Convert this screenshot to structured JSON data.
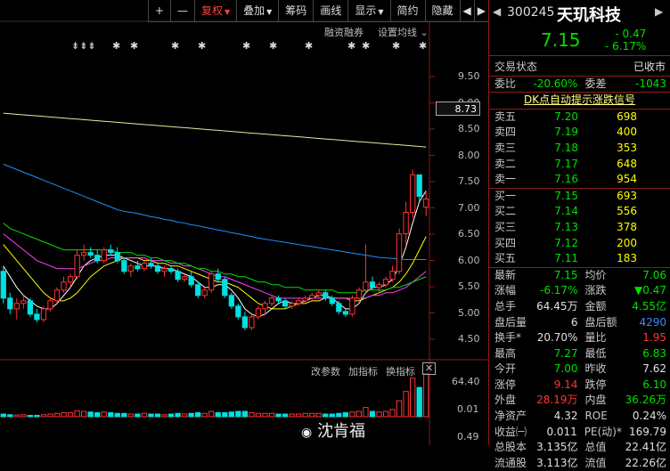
{
  "toolbar": {
    "buttons": [
      "+",
      "—",
      "复权",
      "叠加",
      "筹码",
      "画线",
      "显示",
      "简约",
      "隐藏"
    ],
    "nav_left": "◀",
    "nav_right": "▶"
  },
  "chart_header": {
    "margin_label": "融资融券",
    "ma_setting_label": "设置均线"
  },
  "price_axis": [
    "9.50",
    "9.00",
    "8.50",
    "8.00",
    "7.50",
    "7.00",
    "6.50",
    "6.00",
    "5.50",
    "5.00",
    "4.50"
  ],
  "current_price_tag": "8.73",
  "volume_panel": {
    "buttons": [
      "改参数",
      "加指标",
      "换指标"
    ],
    "close_icon": "✕",
    "axis_top": "64.40",
    "axis_bottom": "0.01",
    "axis_extra": "0.49"
  },
  "markers": [
    "⇟⇟⇟",
    "✱",
    "✱",
    "✱",
    "✱",
    "✱",
    "✱",
    "✱",
    "✱",
    "✱",
    "✱",
    "✱"
  ],
  "watermark": "沈肯福",
  "stock": {
    "nav_left": "◀",
    "code": "300245",
    "name": "天玑科技",
    "nav_right": "▶",
    "price": "7.15",
    "change": "- 0.47",
    "change_pct": "- 6.17%"
  },
  "status": {
    "label": "交易状态",
    "value": "已收市"
  },
  "ratio": {
    "wb_label": "委比",
    "wb_value": "-20.60%",
    "wc_label": "委差",
    "wc_value": "-1043"
  },
  "signal_link": "DK点自动提示涨跌信号",
  "order_book": {
    "asks": [
      {
        "label": "卖五",
        "price": "7.20",
        "vol": "698"
      },
      {
        "label": "卖四",
        "price": "7.19",
        "vol": "400"
      },
      {
        "label": "卖三",
        "price": "7.18",
        "vol": "353"
      },
      {
        "label": "卖二",
        "price": "7.17",
        "vol": "648"
      },
      {
        "label": "卖一",
        "price": "7.16",
        "vol": "954"
      }
    ],
    "bids": [
      {
        "label": "买一",
        "price": "7.15",
        "vol": "693"
      },
      {
        "label": "买二",
        "price": "7.14",
        "vol": "556"
      },
      {
        "label": "买三",
        "price": "7.13",
        "vol": "378"
      },
      {
        "label": "买四",
        "price": "7.12",
        "vol": "200"
      },
      {
        "label": "买五",
        "price": "7.11",
        "vol": "183"
      }
    ]
  },
  "stats": [
    {
      "l1": "最新",
      "v1": "7.15",
      "c1": "green",
      "l2": "均价",
      "v2": "7.06",
      "c2": "green"
    },
    {
      "l1": "涨幅",
      "v1": "-6.17%",
      "c1": "green",
      "l2": "涨跌",
      "v2": "▼0.47",
      "c2": "green"
    },
    {
      "l1": "总手",
      "v1": "64.45万",
      "c1": "white",
      "l2": "金额",
      "v2": "4.55亿",
      "c2": "green"
    },
    {
      "l1": "盘后量",
      "v1": "6",
      "c1": "white",
      "l2": "盘后额",
      "v2": "4290",
      "c2": "blue"
    },
    {
      "l1": "换手*",
      "v1": "20.70%",
      "c1": "white",
      "l2": "量比",
      "v2": "1.95",
      "c2": "red"
    },
    {
      "l1": "最高",
      "v1": "7.27",
      "c1": "green",
      "l2": "最低",
      "v2": "6.83",
      "c2": "green"
    },
    {
      "l1": "今开",
      "v1": "7.00",
      "c1": "green",
      "l2": "昨收",
      "v2": "7.62",
      "c2": "white"
    },
    {
      "l1": "涨停",
      "v1": "9.14",
      "c1": "red",
      "l2": "跌停",
      "v2": "6.10",
      "c2": "green"
    },
    {
      "l1": "外盘",
      "v1": "28.19万",
      "c1": "red",
      "l2": "内盘",
      "v2": "36.26万",
      "c2": "green"
    },
    {
      "l1": "净资产",
      "v1": "4.32",
      "c1": "white",
      "l2": "ROE",
      "v2": "0.24%",
      "c2": "white"
    },
    {
      "l1": "收益㈠",
      "v1": "0.011",
      "c1": "white",
      "l2": "PE(动)*",
      "v2": "169.79",
      "c2": "white"
    },
    {
      "l1": "总股本",
      "v1": "3.135亿",
      "c1": "white",
      "l2": "总值",
      "v2": "22.41亿",
      "c2": "white"
    },
    {
      "l1": "流通股",
      "v1": "3.113亿",
      "c1": "white",
      "l2": "流值",
      "v2": "22.26亿",
      "c2": "white"
    }
  ],
  "chart_data": {
    "type": "candlestick",
    "y_range": [
      4.3,
      9.7
    ],
    "volume_range": [
      0,
      64.4
    ],
    "candles": [
      [
        5.8,
        5.9,
        5.2,
        5.3
      ],
      [
        5.3,
        5.4,
        5.0,
        5.1
      ],
      [
        5.1,
        5.3,
        4.9,
        5.2
      ],
      [
        5.2,
        5.35,
        5.1,
        5.25
      ],
      [
        5.25,
        5.3,
        4.95,
        5.0
      ],
      [
        5.0,
        5.1,
        4.85,
        4.9
      ],
      [
        4.9,
        5.15,
        4.85,
        5.1
      ],
      [
        5.1,
        5.3,
        5.05,
        5.25
      ],
      [
        5.25,
        5.5,
        5.2,
        5.45
      ],
      [
        5.45,
        5.7,
        5.4,
        5.6
      ],
      [
        5.6,
        5.75,
        5.5,
        5.7
      ],
      [
        5.7,
        6.2,
        5.65,
        6.1
      ],
      [
        6.1,
        6.3,
        6.0,
        6.15
      ],
      [
        6.15,
        6.25,
        6.05,
        6.1
      ],
      [
        6.1,
        6.2,
        5.95,
        6.0
      ],
      [
        6.0,
        6.25,
        5.95,
        6.2
      ],
      [
        6.2,
        6.3,
        6.1,
        6.15
      ],
      [
        6.15,
        6.25,
        5.95,
        6.0
      ],
      [
        6.0,
        6.05,
        5.75,
        5.8
      ],
      [
        5.8,
        5.95,
        5.7,
        5.9
      ],
      [
        5.9,
        6.0,
        5.8,
        5.85
      ],
      [
        5.85,
        6.0,
        5.8,
        5.95
      ],
      [
        5.95,
        6.05,
        5.85,
        5.9
      ],
      [
        5.9,
        5.95,
        5.75,
        5.8
      ],
      [
        5.8,
        5.9,
        5.7,
        5.85
      ],
      [
        5.85,
        5.9,
        5.75,
        5.8
      ],
      [
        5.8,
        5.85,
        5.6,
        5.65
      ],
      [
        5.65,
        5.75,
        5.6,
        5.7
      ],
      [
        5.7,
        5.8,
        5.5,
        5.55
      ],
      [
        5.55,
        5.6,
        5.3,
        5.35
      ],
      [
        5.35,
        5.5,
        5.3,
        5.45
      ],
      [
        5.45,
        5.8,
        5.4,
        5.75
      ],
      [
        5.75,
        5.85,
        5.6,
        5.65
      ],
      [
        5.65,
        5.7,
        5.3,
        5.35
      ],
      [
        5.35,
        5.4,
        5.1,
        5.15
      ],
      [
        5.15,
        5.2,
        4.9,
        4.95
      ],
      [
        4.95,
        5.05,
        4.7,
        4.75
      ],
      [
        4.75,
        5.0,
        4.7,
        4.95
      ],
      [
        4.95,
        5.15,
        4.9,
        5.1
      ],
      [
        5.1,
        5.25,
        5.0,
        5.2
      ],
      [
        5.2,
        5.35,
        5.15,
        5.3
      ],
      [
        5.3,
        5.35,
        5.2,
        5.25
      ],
      [
        5.25,
        5.3,
        5.1,
        5.15
      ],
      [
        5.15,
        5.25,
        5.1,
        5.2
      ],
      [
        5.2,
        5.3,
        5.15,
        5.25
      ],
      [
        5.25,
        5.35,
        5.2,
        5.3
      ],
      [
        5.3,
        5.4,
        5.25,
        5.35
      ],
      [
        5.35,
        5.45,
        5.3,
        5.4
      ],
      [
        5.4,
        5.45,
        5.25,
        5.3
      ],
      [
        5.3,
        5.35,
        5.15,
        5.2
      ],
      [
        5.2,
        5.25,
        5.0,
        5.05
      ],
      [
        5.05,
        5.1,
        4.95,
        5.0
      ],
      [
        5.0,
        5.35,
        4.95,
        5.3
      ],
      [
        5.3,
        5.5,
        5.25,
        5.45
      ],
      [
        5.45,
        6.3,
        5.4,
        5.6
      ],
      [
        5.6,
        5.7,
        5.45,
        5.5
      ],
      [
        5.5,
        5.6,
        5.4,
        5.55
      ],
      [
        5.55,
        5.7,
        5.5,
        5.65
      ],
      [
        5.65,
        5.9,
        5.6,
        5.8
      ],
      [
        5.8,
        6.6,
        5.75,
        6.5
      ],
      [
        6.5,
        7.1,
        6.3,
        6.9
      ],
      [
        6.9,
        7.7,
        6.8,
        7.6
      ],
      [
        7.6,
        7.6,
        7.1,
        7.2
      ],
      [
        7.0,
        7.27,
        6.83,
        7.15
      ]
    ],
    "volumes": [
      4,
      3,
      2.5,
      3,
      2,
      2,
      3,
      4,
      5,
      6,
      6,
      9,
      8,
      7,
      6,
      7,
      6,
      5,
      5,
      4,
      4,
      5,
      4,
      4,
      3,
      4,
      5,
      4,
      5,
      6,
      5,
      8,
      6,
      6,
      7,
      8,
      8,
      6,
      5,
      5,
      5,
      4,
      4,
      4,
      4,
      5,
      5,
      5,
      4,
      4,
      5,
      6,
      7,
      8,
      14,
      8,
      7,
      8,
      11,
      24,
      38,
      58,
      44,
      64.4
    ],
    "ma_lines": [
      {
        "color": "#ffffff",
        "values": [
          5.9,
          5.7,
          5.5,
          5.35,
          5.25,
          5.15,
          5.1,
          5.1,
          5.2,
          5.35,
          5.5,
          5.7,
          5.9,
          6.0,
          6.05,
          6.1,
          6.1,
          6.1,
          6.05,
          6.0,
          5.95,
          5.9,
          5.9,
          5.9,
          5.85,
          5.85,
          5.8,
          5.75,
          5.7,
          5.6,
          5.5,
          5.5,
          5.55,
          5.55,
          5.45,
          5.3,
          5.1,
          5.0,
          4.95,
          5.0,
          5.1,
          5.2,
          5.25,
          5.2,
          5.2,
          5.25,
          5.3,
          5.35,
          5.35,
          5.3,
          5.2,
          5.1,
          5.1,
          5.2,
          5.4,
          5.5,
          5.5,
          5.55,
          5.65,
          5.9,
          6.25,
          6.7,
          7.1,
          7.3
        ]
      },
      {
        "color": "#ffff00",
        "values": [
          6.3,
          6.15,
          6.0,
          5.85,
          5.7,
          5.55,
          5.4,
          5.3,
          5.25,
          5.25,
          5.3,
          5.4,
          5.55,
          5.7,
          5.8,
          5.9,
          5.95,
          6.0,
          6.05,
          6.05,
          6.05,
          6.0,
          6.0,
          5.95,
          5.95,
          5.9,
          5.9,
          5.85,
          5.8,
          5.75,
          5.7,
          5.65,
          5.6,
          5.6,
          5.55,
          5.5,
          5.4,
          5.3,
          5.2,
          5.15,
          5.1,
          5.1,
          5.1,
          5.15,
          5.2,
          5.2,
          5.25,
          5.25,
          5.3,
          5.3,
          5.3,
          5.3,
          5.25,
          5.25,
          5.3,
          5.35,
          5.4,
          5.45,
          5.5,
          5.6,
          5.75,
          5.95,
          6.2,
          6.45
        ]
      },
      {
        "color": "#ff40ff",
        "values": [
          6.5,
          6.4,
          6.3,
          6.2,
          6.1,
          6.0,
          5.95,
          5.9,
          5.85,
          5.85,
          5.85,
          5.85,
          5.9,
          5.95,
          6.0,
          6.0,
          6.05,
          6.05,
          6.05,
          6.05,
          6.05,
          6.05,
          6.0,
          6.0,
          6.0,
          5.95,
          5.95,
          5.9,
          5.9,
          5.85,
          5.8,
          5.75,
          5.7,
          5.7,
          5.65,
          5.6,
          5.55,
          5.5,
          5.45,
          5.4,
          5.35,
          5.3,
          5.3,
          5.3,
          5.3,
          5.3,
          5.3,
          5.3,
          5.3,
          5.3,
          5.3,
          5.3,
          5.3,
          5.3,
          5.3,
          5.35,
          5.35,
          5.4,
          5.4,
          5.45,
          5.5,
          5.6,
          5.7,
          5.8
        ]
      },
      {
        "color": "#00e000",
        "values": [
          6.7,
          6.6,
          6.55,
          6.5,
          6.45,
          6.4,
          6.35,
          6.3,
          6.25,
          6.2,
          6.2,
          6.2,
          6.2,
          6.2,
          6.2,
          6.2,
          6.2,
          6.15,
          6.15,
          6.15,
          6.1,
          6.1,
          6.05,
          6.05,
          6.0,
          6.0,
          5.95,
          5.95,
          5.9,
          5.85,
          5.85,
          5.8,
          5.8,
          5.75,
          5.75,
          5.7,
          5.7,
          5.65,
          5.6,
          5.6,
          5.55,
          5.55,
          5.5,
          5.5,
          5.5,
          5.45,
          5.45,
          5.45,
          5.45,
          5.45,
          5.4,
          5.4,
          5.4,
          5.4,
          5.45,
          5.45,
          5.45,
          5.45,
          5.5,
          5.5,
          5.55,
          5.6,
          5.65,
          5.7
        ]
      },
      {
        "color": "#1e90ff",
        "values": [
          7.8,
          7.75,
          7.7,
          7.65,
          7.6,
          7.55,
          7.5,
          7.45,
          7.4,
          7.35,
          7.3,
          7.25,
          7.2,
          7.15,
          7.1,
          7.05,
          7.0,
          6.95,
          6.92,
          6.9,
          6.88,
          6.85,
          6.82,
          6.8,
          6.77,
          6.75,
          6.72,
          6.7,
          6.67,
          6.65,
          6.62,
          6.6,
          6.57,
          6.55,
          6.52,
          6.5,
          6.47,
          6.45,
          6.42,
          6.4,
          6.38,
          6.36,
          6.34,
          6.32,
          6.3,
          6.28,
          6.26,
          6.24,
          6.22,
          6.2,
          6.18,
          6.16,
          6.14,
          6.12,
          6.1,
          6.08,
          6.06,
          6.05,
          6.04,
          6.03,
          6.02,
          6.02,
          6.02,
          6.02
        ]
      },
      {
        "color": "#e8e8a0",
        "values": [
          8.75,
          8.74,
          8.73,
          8.72,
          8.71,
          8.7,
          8.69,
          8.68,
          8.67,
          8.66,
          8.65,
          8.64,
          8.63,
          8.62,
          8.61,
          8.6,
          8.59,
          8.58,
          8.57,
          8.56,
          8.55,
          8.54,
          8.53,
          8.52,
          8.51,
          8.5,
          8.49,
          8.48,
          8.47,
          8.46,
          8.45,
          8.44,
          8.43,
          8.42,
          8.41,
          8.4,
          8.39,
          8.38,
          8.37,
          8.36,
          8.35,
          8.34,
          8.33,
          8.32,
          8.31,
          8.3,
          8.29,
          8.28,
          8.27,
          8.26,
          8.25,
          8.24,
          8.23,
          8.22,
          8.21,
          8.2,
          8.19,
          8.18,
          8.17,
          8.16,
          8.15,
          8.14,
          8.13,
          8.12
        ]
      }
    ]
  }
}
